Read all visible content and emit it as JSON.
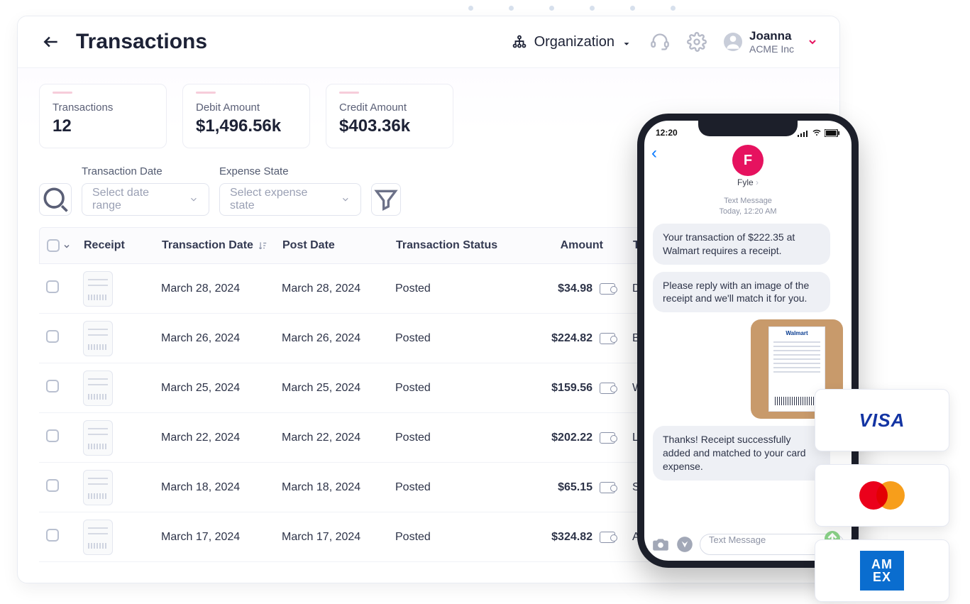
{
  "header": {
    "title": "Transactions",
    "org_label": "Organization",
    "user": {
      "name": "Joanna",
      "company": "ACME Inc"
    }
  },
  "stats": [
    {
      "label": "Transactions",
      "value": "12"
    },
    {
      "label": "Debit Amount",
      "value": "$1,496.56k"
    },
    {
      "label": "Credit Amount",
      "value": "$403.36k"
    }
  ],
  "filters": {
    "date": {
      "label": "Transaction Date",
      "placeholder": "Select date range"
    },
    "state": {
      "label": "Expense State",
      "placeholder": "Select expense state"
    }
  },
  "table": {
    "headers": {
      "receipt": "Receipt",
      "transaction_date": "Transaction Date",
      "post_date": "Post Date",
      "status": "Transaction Status",
      "amount": "Amount",
      "description": "Transaction Description"
    },
    "rows": [
      {
        "tdate": "March 28, 2024",
        "pdate": "March 28, 2024",
        "status": "Posted",
        "amount": "$34.98",
        "desc": "DoorDash"
      },
      {
        "tdate": "March 26, 2024",
        "pdate": "March 26, 2024",
        "status": "Posted",
        "amount": "$224.82",
        "desc": "Best Buy"
      },
      {
        "tdate": "March 25, 2024",
        "pdate": "March 25, 2024",
        "status": "Posted",
        "amount": "$159.56",
        "desc": "Walmart"
      },
      {
        "tdate": "March 22, 2024",
        "pdate": "March 22, 2024",
        "status": "Posted",
        "amount": "$202.22",
        "desc": "Le Cirque"
      },
      {
        "tdate": "March 18, 2024",
        "pdate": "March 18, 2024",
        "status": "Posted",
        "amount": "$65.15",
        "desc": "Starbucks"
      },
      {
        "tdate": "March 17, 2024",
        "pdate": "March 17, 2024",
        "status": "Posted",
        "amount": "$324.82",
        "desc": "Amazon"
      }
    ]
  },
  "phone": {
    "time": "12:20",
    "app_name": "Fyle",
    "meta1": "Text Message",
    "meta2": "Today, 12:20 AM",
    "msg1": "Your transaction of $222.35 at Walmart requires a receipt.",
    "msg2": "Please reply with an image of the receipt and we'll match it for you.",
    "msg3": "Thanks! Receipt successfully added and matched to your card expense.",
    "receipt_logo": "Walmart",
    "input_placeholder": "Text Message"
  },
  "card_labels": {
    "visa": "VISA",
    "amex_top": "AM",
    "amex_bottom": "EX"
  }
}
